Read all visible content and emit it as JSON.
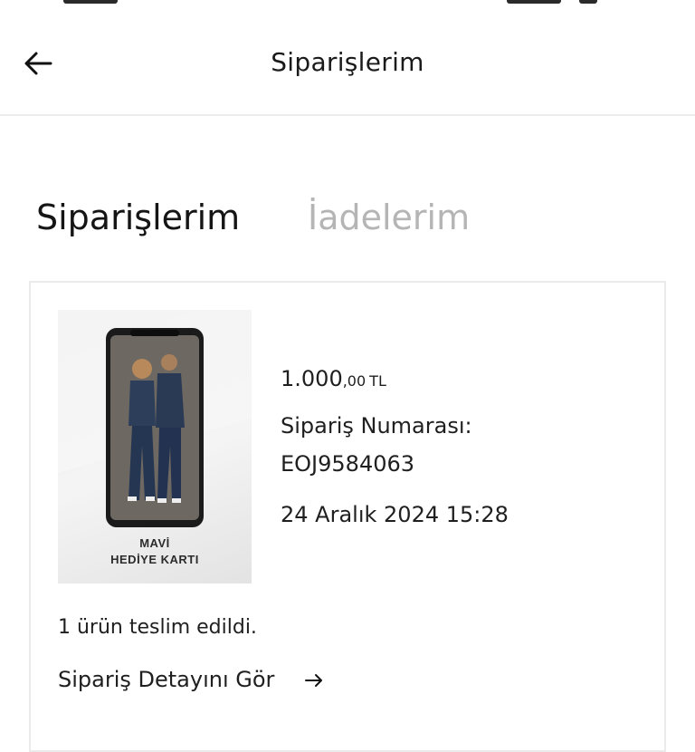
{
  "header": {
    "title": "Siparişlerim",
    "back_icon": "arrow-left-icon"
  },
  "tabs": [
    {
      "label": "Siparişlerim",
      "active": true
    },
    {
      "label": "İadelerim",
      "active": false
    }
  ],
  "order": {
    "thumbnail": {
      "caption_line1": "MAVİ",
      "caption_line2": "HEDİYE KARTI"
    },
    "price": {
      "main": "1.000",
      "minor": ",00",
      "currency": "TL"
    },
    "order_number_label": "Sipariş Numarası:",
    "order_number": "EOJ9584063",
    "date": "24 Aralık 2024 15:28",
    "status_text": "1 ürün teslim edildi.",
    "detail_link": "Sipariş Detayını Gör",
    "detail_icon": "arrow-right-icon"
  },
  "colors": {
    "text": "#1a1a1a",
    "inactive_tab": "#b5b5b5",
    "divider": "#ececec"
  }
}
